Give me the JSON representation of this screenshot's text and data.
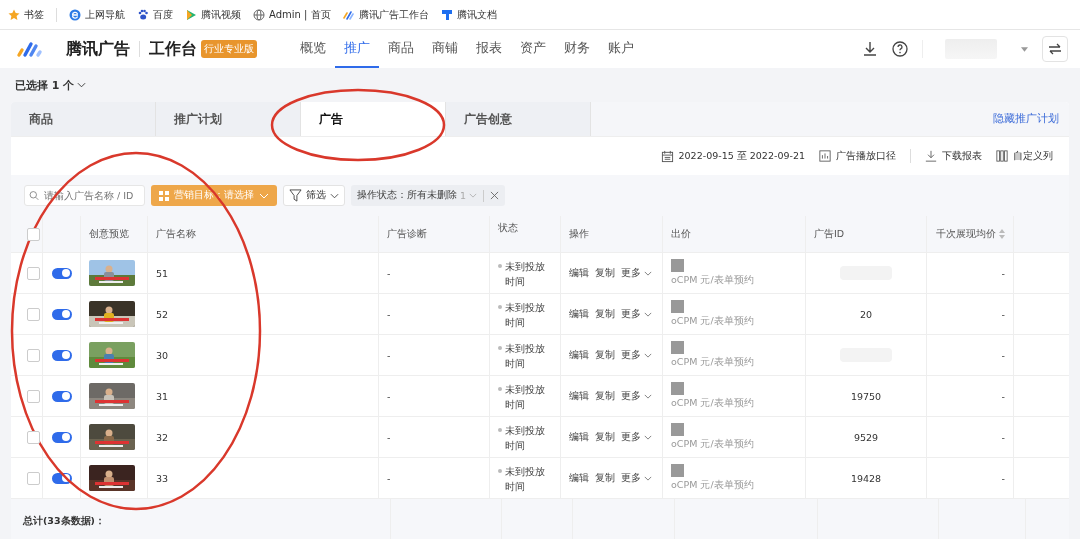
{
  "bookmarks": [
    {
      "label": "书签"
    },
    {
      "label": "上网导航"
    },
    {
      "label": "百度"
    },
    {
      "label": "腾讯视频"
    },
    {
      "label": "Admin | 首页"
    },
    {
      "label": "腾讯广告工作台"
    },
    {
      "label": "腾讯文档"
    }
  ],
  "header": {
    "brand": "腾讯广告",
    "product": "工作台",
    "badge": "行业专业版",
    "nav": [
      {
        "label": "概览",
        "selected": false
      },
      {
        "label": "推广",
        "selected": true
      },
      {
        "label": "商品",
        "selected": false
      },
      {
        "label": "商铺",
        "selected": false
      },
      {
        "label": "报表",
        "selected": false
      },
      {
        "label": "资产",
        "selected": false
      },
      {
        "label": "财务",
        "selected": false
      },
      {
        "label": "账户",
        "selected": false
      }
    ]
  },
  "selection": "已选择 1 个",
  "tabs": [
    {
      "label": "商品",
      "selected": false
    },
    {
      "label": "推广计划",
      "selected": false
    },
    {
      "label": "广告",
      "selected": true
    },
    {
      "label": "广告创意",
      "selected": false
    }
  ],
  "hide_link": "隐藏推广计划",
  "toolbar": {
    "date_range": "2022-09-15 至 2022-09-21",
    "actions": [
      "广告播放口径",
      "下载报表",
      "自定义列"
    ]
  },
  "filters": {
    "search": {
      "placeholder": "请输入广告名称 / ID"
    },
    "marketing": "营销目标：请选择",
    "filter": "筛选",
    "status_chip": "操作状态：所有未删除",
    "status_count": "1"
  },
  "select_all_checked": false,
  "columns": [
    "创意预览",
    "广告名称",
    "广告诊断",
    "状态",
    "操作",
    "出价",
    "广告ID",
    "千次展现均价"
  ],
  "rows": [
    {
      "checked": false,
      "on": true,
      "name": "51",
      "diagnosis": "-",
      "status": "未到投放时间",
      "actions": [
        "编辑",
        "复制",
        "更多"
      ],
      "bid_unit": "oCPM 元/表单预约",
      "cpm": "-"
    },
    {
      "checked": false,
      "on": true,
      "name": "52",
      "diagnosis": "-",
      "status": "未到投放时间",
      "actions": [
        "编辑",
        "复制",
        "更多"
      ],
      "bid_unit": "oCPM 元/表单预约",
      "ad_id": "20",
      "cpm": "-"
    },
    {
      "checked": false,
      "on": true,
      "name": "30",
      "diagnosis": "-",
      "status": "未到投放时间",
      "actions": [
        "编辑",
        "复制",
        "更多"
      ],
      "bid_unit": "oCPM 元/表单预约",
      "cpm": "-"
    },
    {
      "checked": false,
      "on": true,
      "name": "31",
      "diagnosis": "-",
      "status": "未到投放时间",
      "actions": [
        "编辑",
        "复制",
        "更多"
      ],
      "bid_unit": "oCPM 元/表单预约",
      "ad_id": "19750",
      "cpm": "-"
    },
    {
      "checked": false,
      "on": true,
      "name": "32",
      "diagnosis": "-",
      "status": "未到投放时间",
      "actions": [
        "编辑",
        "复制",
        "更多"
      ],
      "bid_unit": "oCPM 元/表单预约",
      "ad_id": "9529",
      "cpm": "-"
    },
    {
      "checked": false,
      "on": true,
      "name": "33",
      "diagnosis": "-",
      "status": "未到投放时间",
      "actions": [
        "编辑",
        "复制",
        "更多"
      ],
      "bid_unit": "oCPM 元/表单预约",
      "ad_id": "19428",
      "cpm": "-"
    }
  ],
  "footer": "总计(33条数据)："
}
